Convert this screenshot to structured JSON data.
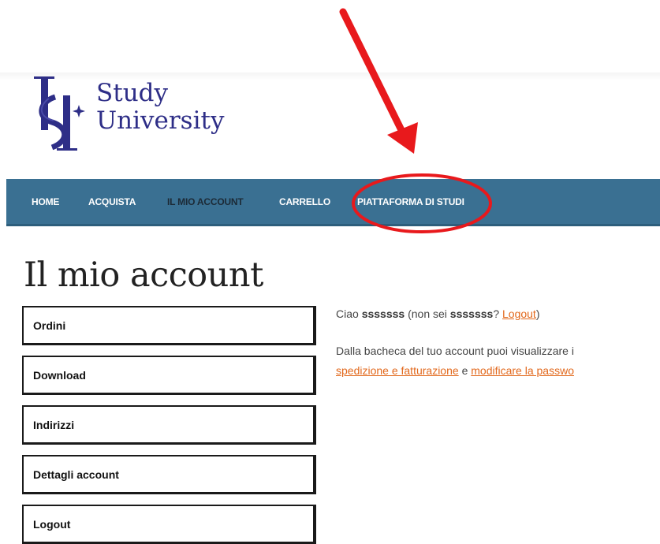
{
  "logo": {
    "line1": "Study",
    "line2": "University",
    "brand_color": "#2e2e87"
  },
  "nav": {
    "items": [
      "HOME",
      "ACQUISTA",
      "IL MIO ACCOUNT",
      "CARRELLO",
      "PIATTAFORMA DI STUDI"
    ],
    "active": "IL MIO ACCOUNT",
    "background": "#3a7092"
  },
  "page": {
    "title": "Il mio account"
  },
  "account_nav": {
    "items": [
      "Ordini",
      "Download",
      "Indirizzi",
      "Dettagli account",
      "Logout"
    ]
  },
  "greeting": {
    "hello": "Ciao",
    "username": "sssssss",
    "not_you_prefix": "(non sei",
    "username2": "sssssss",
    "question": "?",
    "logout_link": "Logout",
    "close_paren": ")"
  },
  "description": {
    "line1": "Dalla bacheca del tuo account puoi visualizzare i",
    "link1": "spedizione e fatturazione",
    "between": "e",
    "link2": "modificare la passwo"
  },
  "colors": {
    "link": "#e2681c",
    "annotation": "#e8191c"
  }
}
